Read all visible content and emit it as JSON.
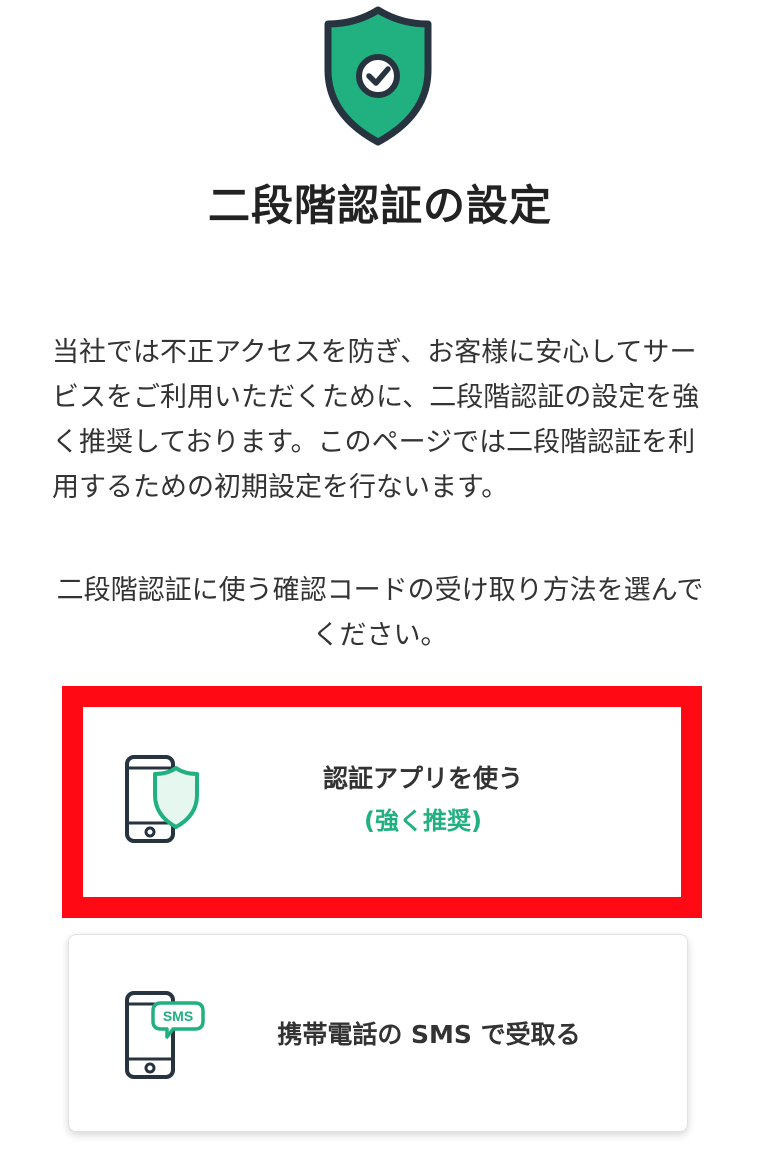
{
  "page": {
    "title": "二段階認証の設定",
    "intro": "当社では不正アクセスを防ぎ、お客様に安心してサービスをご利用いただくために、二段階認証の設定を強く推奨しております。このページでは二段階認証を利用するための初期設定を行ないます。",
    "instruction": "二段階認証に使う確認コードの受け取り方法を選んでください。"
  },
  "icons": {
    "header": "shield-check-icon",
    "app_option": "phone-shield-icon",
    "sms_option": "phone-sms-icon",
    "sms_bubble_text": "SMS"
  },
  "options": {
    "app": {
      "label": "認証アプリを使う",
      "sublabel": "(強く推奨)"
    },
    "sms": {
      "label": "携帯電話の SMS で受取る"
    }
  },
  "colors": {
    "accent_green": "#21b07f",
    "shield_dark": "#27333f",
    "highlight_red": "#ff0a14"
  }
}
